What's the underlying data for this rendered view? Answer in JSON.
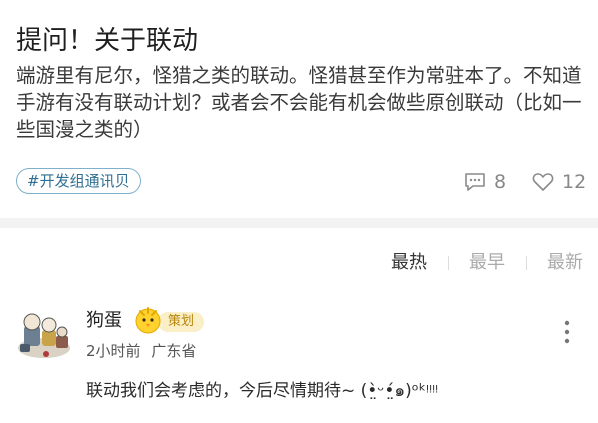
{
  "post": {
    "title": "提问！关于联动",
    "body": "端游里有尼尔，怪猎之类的联动。怪猎甚至作为常驻本了。不知道手游有没有联动计划？或者会不会能有机会做些原创联动（比如一些国漫之类的）",
    "tag": "#开发组通讯贝",
    "comment_count": "8",
    "like_count": "12",
    "icons": {
      "comments": "comment-bubble-icon",
      "likes": "heart-icon"
    }
  },
  "sort": {
    "hot": "最热",
    "earliest": "最早",
    "latest": "最新",
    "active": "hot"
  },
  "comment": {
    "username": "狗蛋",
    "badge": "策划",
    "time": "2小时前",
    "location": "广东省",
    "text": "联动我们会考虑的，今后尽情期待~ (•̤̀ᵕ•̤́๑)ᵒᵏᵎᵎᵎᵎ",
    "colors": {
      "badge_bg": "#fbefc7",
      "badge_text": "#b8860b"
    }
  },
  "colors": {
    "tag_border": "#7fb0cc",
    "tag_text": "#2f6f93",
    "muted": "#888888"
  }
}
